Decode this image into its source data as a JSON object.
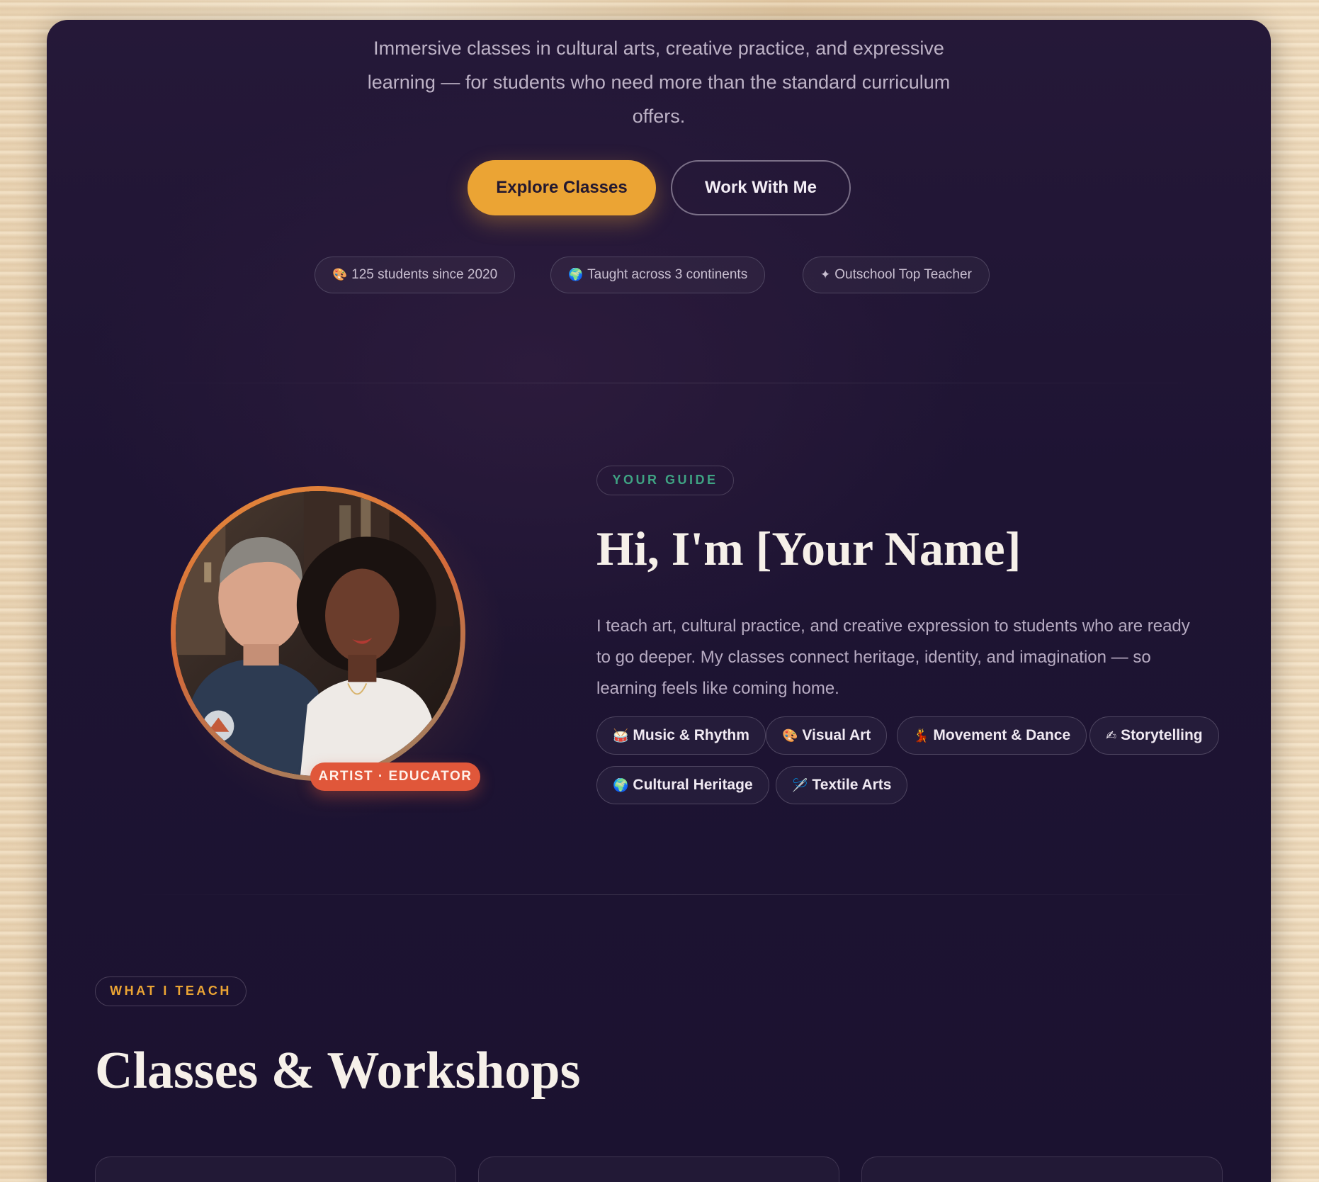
{
  "hero": {
    "subtitle_lines": [
      "Immersive classes in cultural arts, creative practice, and expressive",
      "learning — for students who need more than the standard curriculum",
      "offers."
    ],
    "primary_button": "Explore Classes",
    "secondary_button": "Work With Me",
    "stats": [
      {
        "icon": "🎨",
        "icon_name": "palette-icon",
        "text": "125 students since 2020"
      },
      {
        "icon": "🌍",
        "icon_name": "globe-icon",
        "text": "Taught across 3 continents"
      },
      {
        "icon": "✦",
        "icon_name": "sparkle-icon",
        "text": "Outschool Top Teacher"
      }
    ]
  },
  "guide": {
    "label": "YOUR GUIDE",
    "badge": "ARTIST · EDUCATOR",
    "title": "Hi, I'm [Your Name]",
    "bio_lines": [
      "I teach art, cultural practice, and creative expression to students who are ready",
      "to go deeper. My classes connect heritage, identity, and imagination — so",
      "learning feels like coming home."
    ],
    "tags": [
      {
        "icon": "🥁",
        "icon_name": "drum-icon",
        "label": "Music & Rhythm"
      },
      {
        "icon": "🎨",
        "icon_name": "palette-icon",
        "label": "Visual Art"
      },
      {
        "icon": "💃",
        "icon_name": "dancer-icon",
        "label": "Movement & Dance"
      },
      {
        "icon": "✍",
        "icon_name": "writing-hand-icon",
        "label": "Storytelling"
      },
      {
        "icon": "🌍",
        "icon_name": "globe-icon",
        "label": "Cultural Heritage"
      },
      {
        "icon": "🪡",
        "icon_name": "needle-icon",
        "label": "Textile Arts"
      }
    ]
  },
  "classes": {
    "label": "WHAT I TEACH",
    "title": "Classes & Workshops"
  },
  "colors": {
    "accent": "#eba434",
    "guide_label": "#3fa383",
    "badge": "#e0573a",
    "background": "#1e1433"
  }
}
